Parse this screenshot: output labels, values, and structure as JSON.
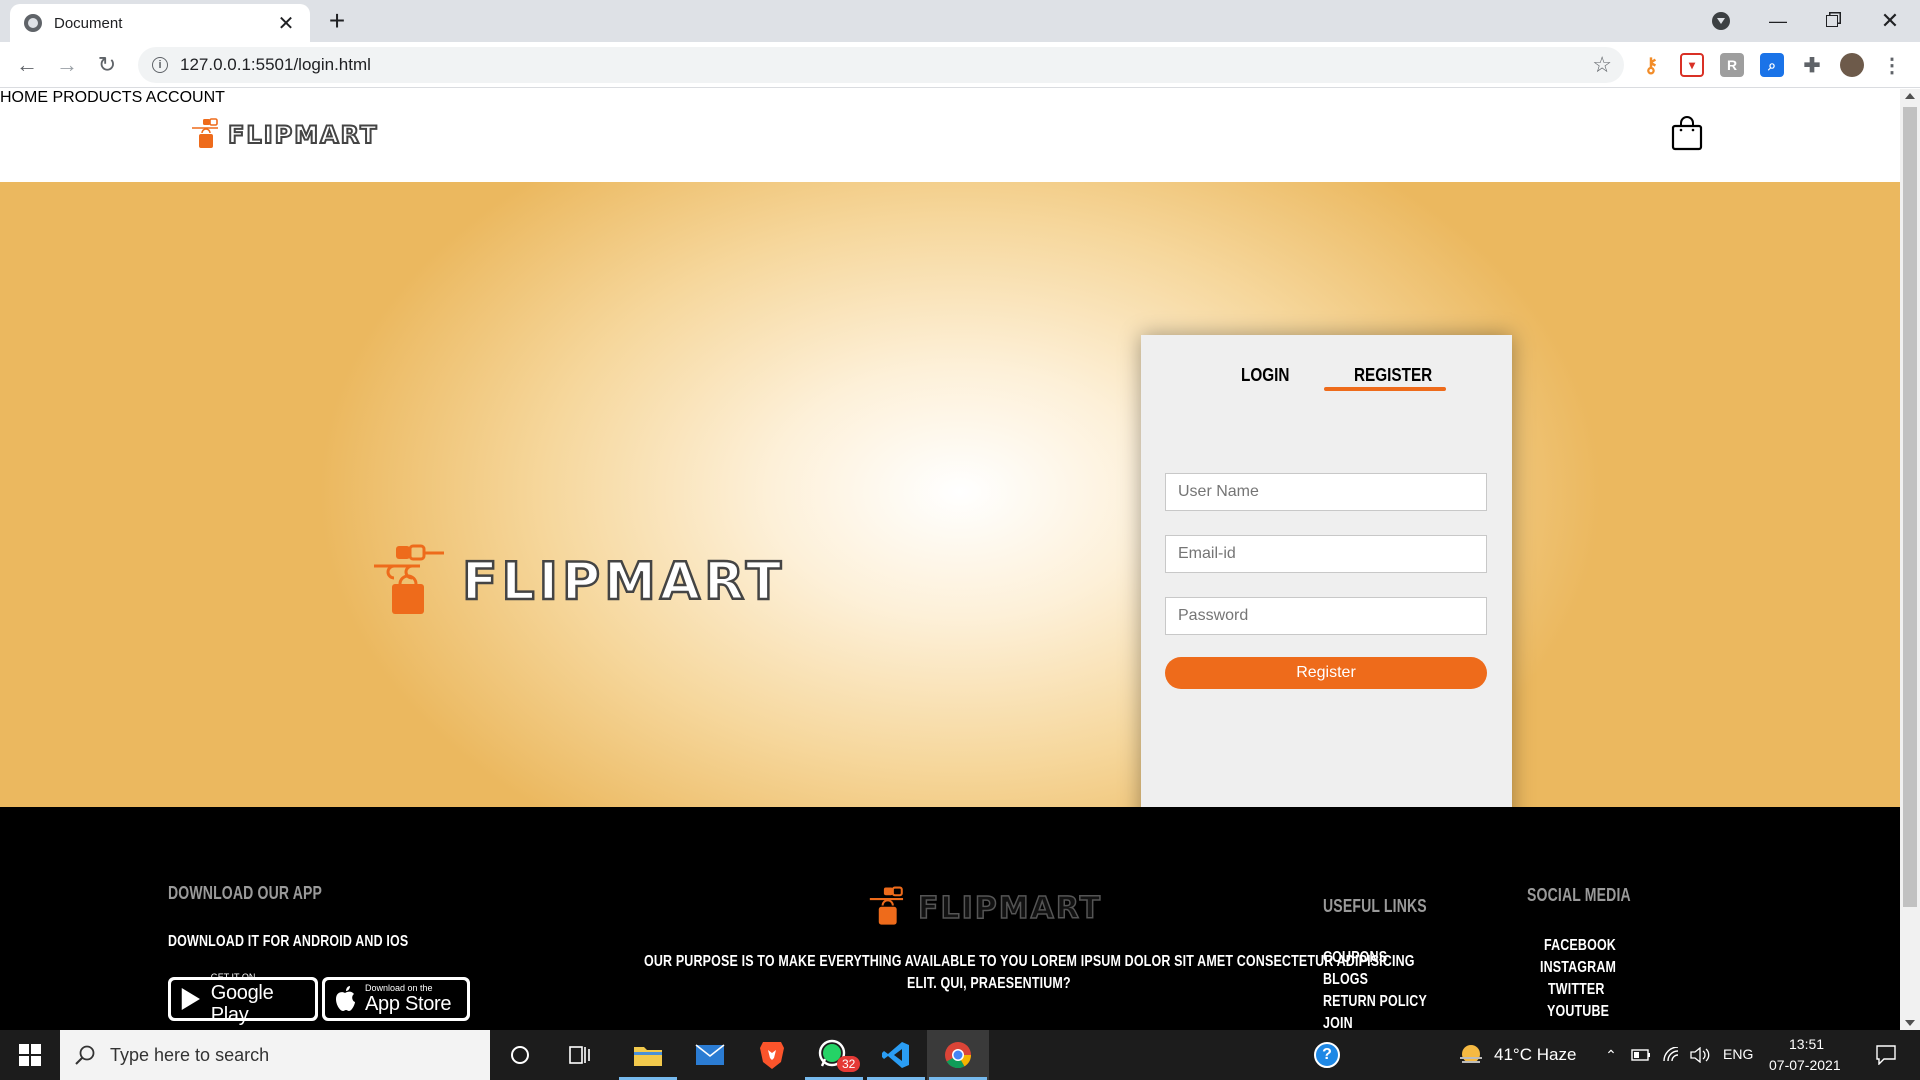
{
  "browser": {
    "tab_title": "Document",
    "tab_close": "✕",
    "new_tab": "+",
    "url": "127.0.0.1:5501/login.html",
    "minimize": "—",
    "close": "✕"
  },
  "site": {
    "brand": "FLIPMART",
    "nav": {
      "home": "HOME",
      "products": "PRODUCTS",
      "account": "ACCOUNT"
    }
  },
  "form": {
    "tab_login": "LOGIN",
    "tab_register": "REGISTER",
    "username_placeholder": "User Name",
    "email_placeholder": "Email-id",
    "password_placeholder": "Password",
    "submit_label": "Register"
  },
  "footer": {
    "download_title": "DOWNLOAD OUR APP",
    "download_subtitle": "DOWNLOAD IT FOR ANDROID AND IOS",
    "google_small": "GET IT ON",
    "google_big": "Google Play",
    "apple_small": "Download on the",
    "apple_big": "App Store",
    "purpose_line1": "OUR PURPOSE IS TO MAKE EVERYTHING AVAILABLE TO YOU LOREM IPSUM DOLOR SIT AMET CONSECTETUR ADIPISICING",
    "purpose_line2": "ELIT. QUI, PRAESENTIUM?",
    "useful_title": "USEFUL LINKS",
    "useful_links": [
      "COUPONS",
      "BLOGS",
      "RETURN POLICY",
      "JOIN"
    ],
    "social_title": "SOCIAL MEDIA",
    "social_links": [
      "FACEBOOK",
      "INSTAGRAM",
      "TWITTER",
      "YOUTUBE"
    ]
  },
  "taskbar": {
    "search_placeholder": "Type here to search",
    "whatsapp_badge": "32",
    "weather": "41°C  Haze",
    "language": "ENG",
    "time": "13:51",
    "date": "07-07-2021"
  },
  "colors": {
    "accent": "#ee6b1b",
    "footer_bg": "#000000",
    "hero_edge": "#ebb85f"
  }
}
